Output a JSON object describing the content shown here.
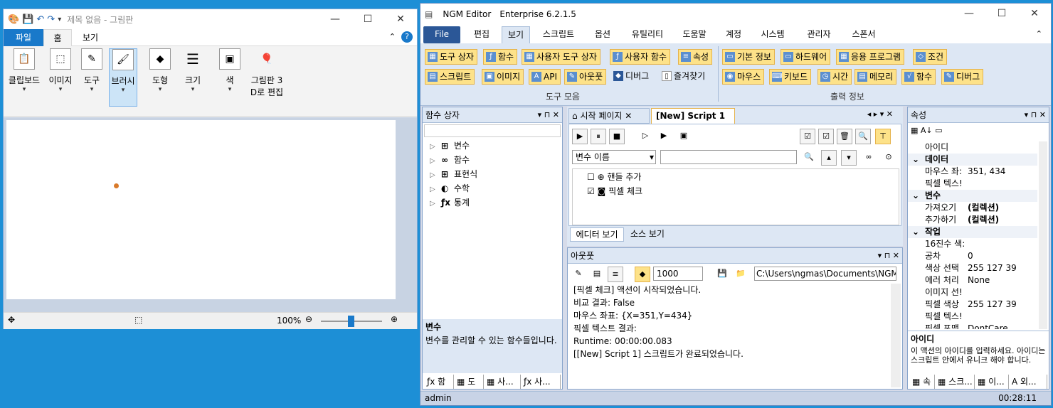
{
  "paint": {
    "title": "제목 없음 - 그림판",
    "menu": {
      "file": "파일",
      "home": "홈",
      "view": "보기"
    },
    "ribbon": {
      "clipboard": "클립보드",
      "image": "이미지",
      "tools": "도구",
      "brushes": "브러시",
      "shapes": "도형",
      "size": "크기",
      "colors": "색",
      "paint3d": "그림판 3 D로 편집"
    },
    "status": {
      "zoom": "100%"
    }
  },
  "ngm": {
    "title": "NGM Editor",
    "version": "Enterprise 6.2.1.5",
    "tabs": [
      "File",
      "편집",
      "보기",
      "스크립트",
      "옵션",
      "유틸리티",
      "도움말",
      "계정",
      "시스템",
      "관리자",
      "스폰서"
    ],
    "ribbon": {
      "row1": [
        "도구 상자",
        "함수",
        "사용자 도구 상자",
        "사용자 함수",
        "속성"
      ],
      "row2": [
        "스크립트",
        "이미지",
        "API",
        "아웃풋",
        "디버그",
        "즐겨찾기"
      ],
      "group1_caption": "도구 모음",
      "row1b": [
        "기본 정보",
        "하드웨어",
        "응용 프로그램",
        "조건"
      ],
      "row2b": [
        "마우스",
        "키보드",
        "시간",
        "메모리",
        "함수",
        "디버그"
      ],
      "group2_caption": "출력 정보"
    },
    "func_panel": {
      "title": "함수 상자",
      "items": [
        "변수",
        "함수",
        "표현식",
        "수학",
        "통계"
      ],
      "desc_title": "변수",
      "desc": "변수를 관리할 수 있는 함수들입니다.",
      "bottom_tabs": [
        "함",
        "도",
        "사...",
        "사..."
      ]
    },
    "editor": {
      "tab_start": "시작 페이지",
      "tab_script": "[New] Script 1",
      "var_combo": "변수 이름",
      "actions": [
        "핸들 추가",
        "픽셀 체크"
      ],
      "bottom_tabs": [
        "에디터 보기",
        "소스 보기"
      ]
    },
    "output": {
      "title": "아웃풋",
      "interval": "1000",
      "path": "C:\\Users\\ngmas\\Documents\\NGM6\\",
      "lines": [
        "[픽셀 체크] 액션이 시작되었습니다.",
        "비교 결과: False",
        "마우스 좌표: {X=351,Y=434}",
        "픽셀 텍스트 결과:",
        "Runtime: 00:00:00.083",
        "[[New] Script 1] 스크립트가 완료되었습니다."
      ]
    },
    "props": {
      "title": "속성",
      "rows": [
        {
          "k": "아이디",
          "v": "",
          "cat": false
        },
        {
          "k": "데이터",
          "v": "",
          "cat": true
        },
        {
          "k": "마우스 좌:",
          "v": "351, 434",
          "cat": false
        },
        {
          "k": "픽셀 텍스!",
          "v": "",
          "cat": false
        },
        {
          "k": "변수",
          "v": "",
          "cat": true
        },
        {
          "k": "가져오기",
          "v": "(컬렉션)",
          "cat": false
        },
        {
          "k": "추가하기",
          "v": "(컬렉션)",
          "cat": false
        },
        {
          "k": "작업",
          "v": "",
          "cat": true
        },
        {
          "k": "16진수 색:",
          "v": "",
          "cat": false
        },
        {
          "k": "공차",
          "v": "0",
          "cat": false
        },
        {
          "k": "색상 선택",
          "v": "255 127 39",
          "cat": false
        },
        {
          "k": "에러 처리",
          "v": "None",
          "cat": false
        },
        {
          "k": "이미지 선!",
          "v": "",
          "cat": false
        },
        {
          "k": "픽셀 색상",
          "v": "255 127 39",
          "cat": false
        },
        {
          "k": "픽셀 텍스!",
          "v": "",
          "cat": false
        },
        {
          "k": "픽셀 포맷",
          "v": "DontCare",
          "cat": false
        }
      ],
      "desc_title": "아이디",
      "desc": "이 액션의 아이디를 입력하세요. 아이디는 스크립트 안에서 유니크 해야 합니다.",
      "bottom_tabs": [
        "속",
        "스크...",
        "이...",
        "외..."
      ]
    },
    "statusbar": {
      "user": "admin",
      "time": "00:28:11"
    }
  }
}
